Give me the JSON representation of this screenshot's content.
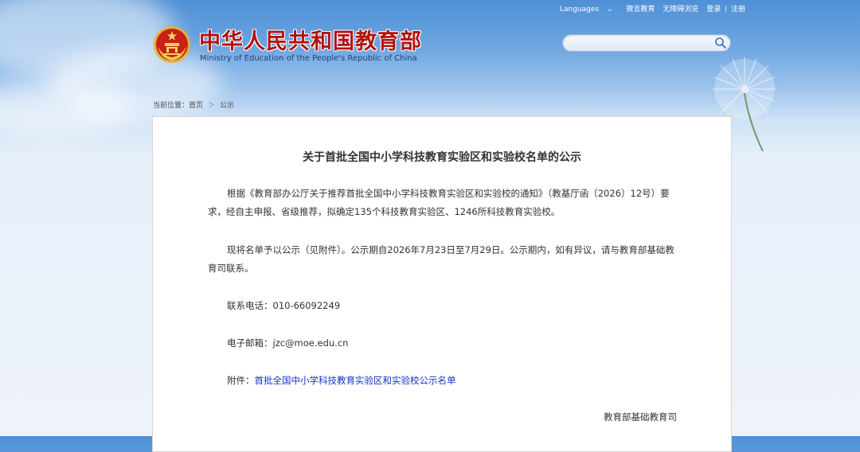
{
  "header": {
    "top_links": [
      "Languages",
      "微言教育",
      "无障碍浏览",
      "登录",
      "注册"
    ],
    "top_separator": "|",
    "logo_cn": "中华人民共和国教育部",
    "logo_en": "Ministry of Education of the People's Republic of China",
    "search": {
      "value": "",
      "placeholder": ""
    }
  },
  "breadcrumb": {
    "label": "当前位置：",
    "home": "首页",
    "separator": "＞",
    "current": "公示"
  },
  "article": {
    "title": "关于首批全国中小学科技教育实验区和实验校名单的公示",
    "para1": "根据《教育部办公厅关于推荐首批全国中小学科技教育实验区和实验校的通知》（教基厅函〔2026〕12号）要求，经自主申报、省级推荐，拟确定135个科技教育实验区、1246所科技教育实验校。",
    "para2": "现将名单予以公示（见附件）。公示期自2026年7月23日至7月29日。公示期内，如有异议，请与教育部基础教育司联系。",
    "phone": "联系电话：010-66092249",
    "email": "电子邮箱：jzc@moe.edu.cn",
    "attach_label": "附件：",
    "attach_link": "首批全国中小学科技教育实验区和实验校公示名单",
    "signature": "教育部基础教育司"
  },
  "colors": {
    "logo_red": "#b2120f",
    "link_blue": "#1432c8",
    "sky_blue": "#4f90d6"
  },
  "icons": [
    "national-emblem-icon",
    "search-icon",
    "chevron-down-icon",
    "dandelion-decoration"
  ]
}
